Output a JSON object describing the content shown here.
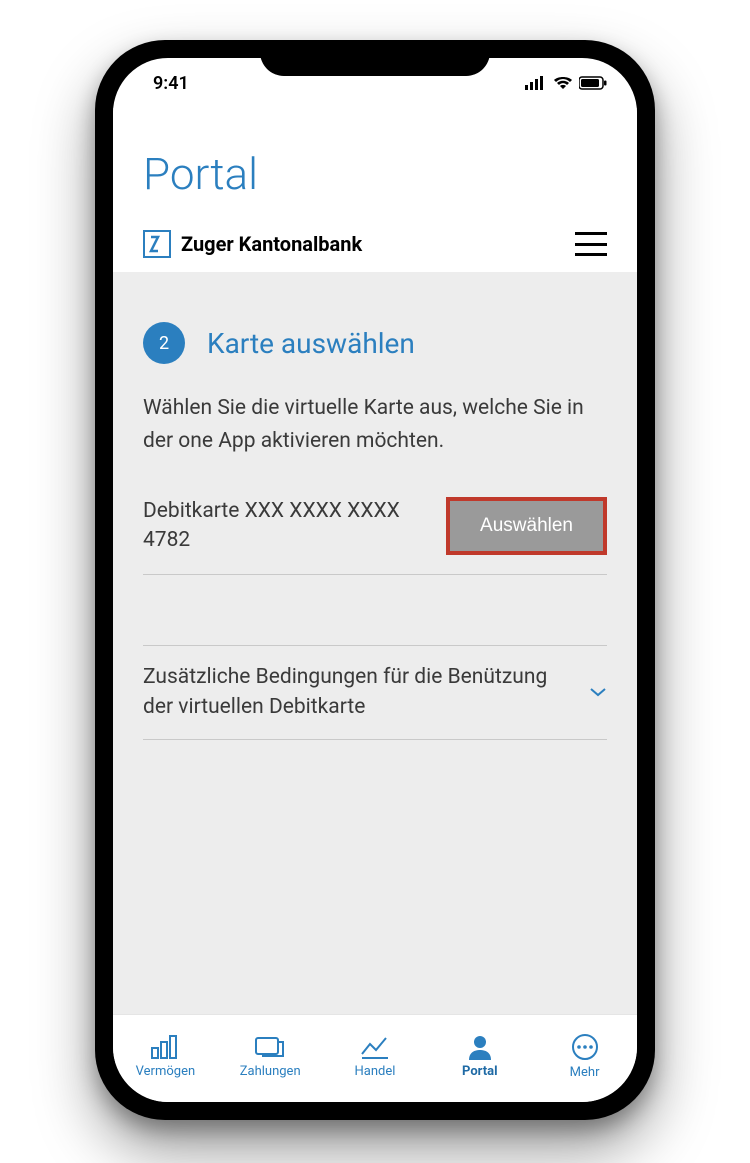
{
  "status": {
    "time": "9:41"
  },
  "page": {
    "title": "Portal"
  },
  "bank": {
    "name": "Zuger Kantonalbank"
  },
  "step": {
    "number": "2",
    "title": "Karte auswählen",
    "description": "Wählen Sie die virtuelle Karte aus, welche Sie in der one App aktivieren möchten."
  },
  "card": {
    "label": "Debitkarte XXX XXXX XXXX 4782",
    "button": "Auswählen"
  },
  "conditions": {
    "label": "Zusätzliche Bedingungen für die Benützung der virtuellen Debitkarte"
  },
  "tabs": {
    "wealth": "Vermögen",
    "payments": "Zahlungen",
    "trade": "Handel",
    "portal": "Portal",
    "more": "Mehr"
  },
  "colors": {
    "accent": "#2b7fbf",
    "highlight_border": "#c0392b"
  }
}
